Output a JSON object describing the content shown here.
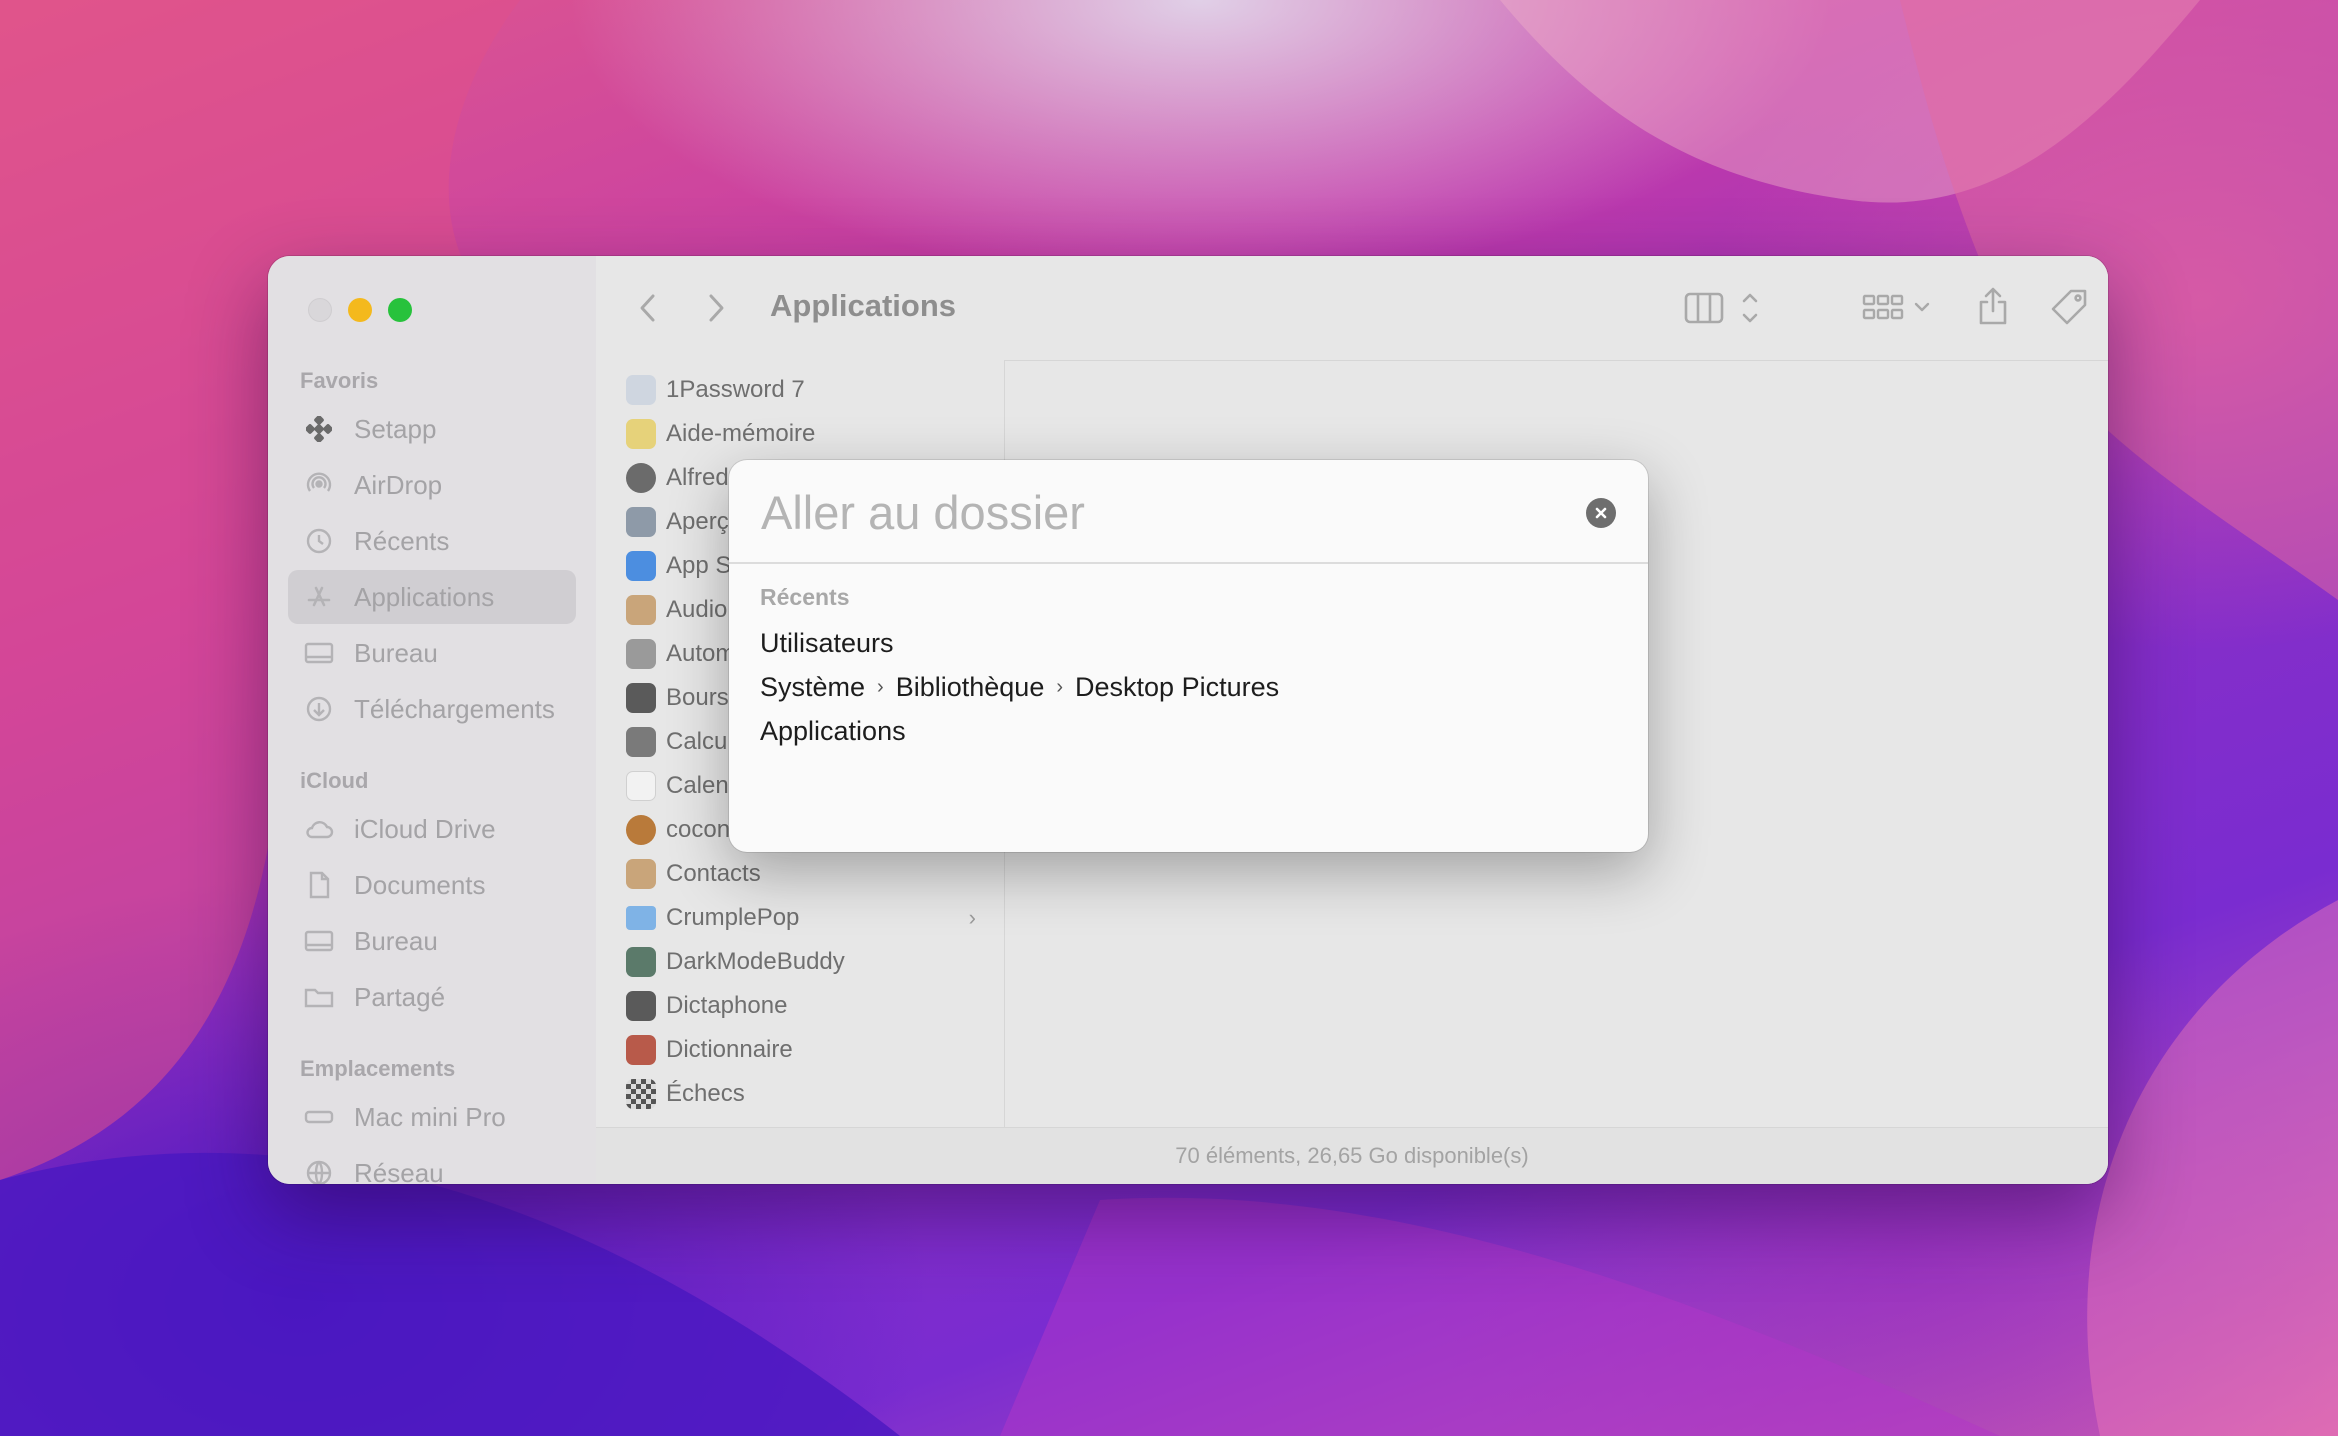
{
  "window": {
    "title": "Applications",
    "status": "70 éléments, 26,65 Go disponible(s)"
  },
  "sidebar": {
    "favorites_header": "Favoris",
    "favorites": [
      {
        "label": "Setapp",
        "icon": "setapp-icon"
      },
      {
        "label": "AirDrop",
        "icon": "airdrop-icon"
      },
      {
        "label": "Récents",
        "icon": "clock-icon"
      },
      {
        "label": "Applications",
        "icon": "applications-icon",
        "selected": true
      },
      {
        "label": "Bureau",
        "icon": "desktop-icon"
      },
      {
        "label": "Téléchargements",
        "icon": "download-icon"
      }
    ],
    "icloud_header": "iCloud",
    "icloud": [
      {
        "label": "iCloud Drive",
        "icon": "cloud-icon"
      },
      {
        "label": "Documents",
        "icon": "document-icon"
      },
      {
        "label": "Bureau",
        "icon": "desktop-icon"
      },
      {
        "label": "Partagé",
        "icon": "shared-folder-icon"
      }
    ],
    "locations_header": "Emplacements",
    "locations": [
      {
        "label": "Mac mini Pro",
        "icon": "computer-icon"
      },
      {
        "label": "Réseau",
        "icon": "network-icon"
      }
    ]
  },
  "files": [
    {
      "label": "1Password 7",
      "color": "#cfd6e0"
    },
    {
      "label": "Aide-mémoire",
      "color": "#e6d27a"
    },
    {
      "label": "Alfred",
      "color": "#6b6b6b"
    },
    {
      "label": "Aperçu",
      "color": "#8e9aa8"
    },
    {
      "label": "App Store",
      "color": "#4c8ee0"
    },
    {
      "label": "Audio",
      "color": "#c9a57a"
    },
    {
      "label": "Automator",
      "color": "#9a9a9a"
    },
    {
      "label": "Bourse",
      "color": "#5a5a5a"
    },
    {
      "label": "Calculette",
      "color": "#7a7a7a"
    },
    {
      "label": "Calendrier",
      "color": "#f2f2f2"
    },
    {
      "label": "coconut",
      "color": "#b97a3a"
    },
    {
      "label": "Contacts",
      "color": "#c9a57a"
    },
    {
      "label": "CrumplePop",
      "color": "#7fb3e6",
      "folder": true
    },
    {
      "label": "DarkModeBuddy",
      "color": "#5b7a6a"
    },
    {
      "label": "Dictaphone",
      "color": "#5a5a5a"
    },
    {
      "label": "Dictionnaire",
      "color": "#b85a4a"
    },
    {
      "label": "Échecs",
      "color": "#6a6a6a"
    }
  ],
  "dialog": {
    "placeholder": "Aller au dossier",
    "value": "",
    "recents_header": "Récents",
    "recents": [
      {
        "label": "Utilisateurs"
      },
      {
        "path": [
          "Système",
          "Bibliothèque",
          "Desktop Pictures"
        ]
      },
      {
        "label": "Applications"
      }
    ]
  }
}
